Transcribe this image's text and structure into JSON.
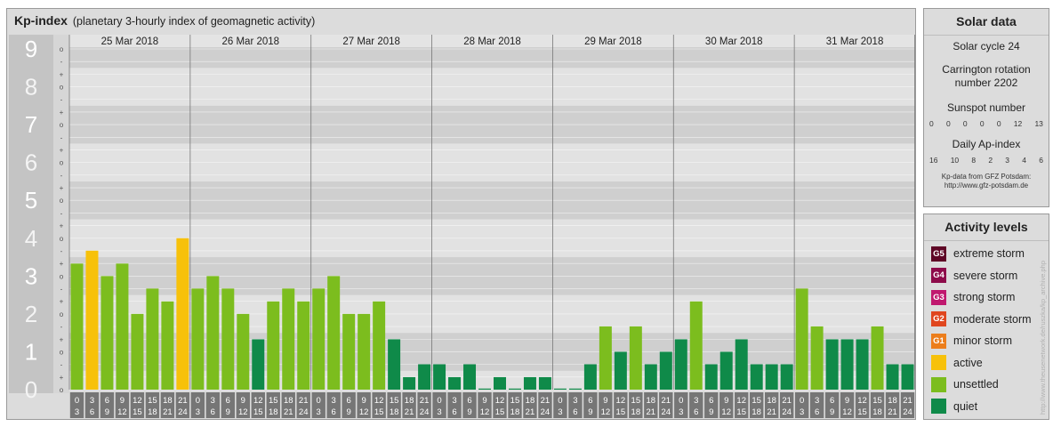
{
  "header": {
    "title": "Kp-index",
    "subtitle": "(planetary 3-hourly index of geomagnetic activity)"
  },
  "chart_data": {
    "type": "bar",
    "title": "Kp-index",
    "subtitle": "(planetary 3-hourly index of geomagnetic activity)",
    "ylim": [
      0,
      9.33
    ],
    "y_ticks": [
      "0",
      "1",
      "2",
      "3",
      "4",
      "5",
      "6",
      "7",
      "8",
      "9"
    ],
    "minor_ticks": [
      "o",
      "+",
      "-"
    ],
    "days": [
      "25 Mar 2018",
      "26 Mar 2018",
      "27 Mar 2018",
      "28 Mar 2018",
      "29 Mar 2018",
      "30 Mar 2018",
      "31 Mar 2018"
    ],
    "interval_labels": [
      [
        "0",
        "3"
      ],
      [
        "3",
        "6"
      ],
      [
        "6",
        "9"
      ],
      [
        "9",
        "12"
      ],
      [
        "12",
        "15"
      ],
      [
        "15",
        "18"
      ],
      [
        "18",
        "21"
      ],
      [
        "21",
        "24"
      ]
    ],
    "values": [
      3.33,
      3.67,
      3.0,
      3.33,
      2.0,
      2.67,
      2.33,
      4.0,
      2.67,
      3.0,
      2.67,
      2.0,
      1.33,
      2.33,
      2.67,
      2.33,
      2.67,
      3.0,
      2.0,
      2.0,
      2.33,
      1.33,
      0.33,
      0.67,
      0.67,
      0.33,
      0.67,
      0.0,
      0.33,
      0.0,
      0.33,
      0.33,
      0.0,
      0.0,
      0.67,
      1.67,
      1.0,
      1.67,
      0.67,
      1.0,
      1.33,
      2.33,
      0.67,
      1.0,
      1.33,
      0.67,
      0.67,
      0.67,
      2.67,
      1.67,
      1.33,
      1.33,
      1.33,
      1.67,
      0.67,
      0.67
    ],
    "activity_colors": {
      "quiet": "#0f8a49",
      "unsettled": "#7cbd1e",
      "active": "#f7c10a"
    }
  },
  "solar": {
    "title": "Solar data",
    "cycle": "Solar cycle 24",
    "carrington_line1": "Carrington rotation",
    "carrington_line2": "number 2202",
    "sunspot_title": "Sunspot number",
    "sunspot_values": [
      "0",
      "0",
      "0",
      "0",
      "0",
      "12",
      "13"
    ],
    "ap_title": "Daily Ap-index",
    "ap_values": [
      "16",
      "10",
      "8",
      "2",
      "3",
      "4",
      "6"
    ],
    "source_line1": "Kp-data from GFZ Potsdam:",
    "source_line2": "http://www.gfz-potsdam.de"
  },
  "activity": {
    "title": "Activity levels",
    "items": [
      {
        "code": "G5",
        "label": "extreme storm",
        "color": "#5e0525"
      },
      {
        "code": "G4",
        "label": "severe storm",
        "color": "#8d0b4a"
      },
      {
        "code": "G3",
        "label": "strong storm",
        "color": "#c0186f"
      },
      {
        "code": "G2",
        "label": "moderate storm",
        "color": "#e0461e"
      },
      {
        "code": "G1",
        "label": "minor storm",
        "color": "#ec7e1c"
      },
      {
        "code": "",
        "label": "active",
        "color": "#f7c10a"
      },
      {
        "code": "",
        "label": "unsettled",
        "color": "#7cbd1e"
      },
      {
        "code": "",
        "label": "quiet",
        "color": "#0f8a49"
      }
    ]
  },
  "credit": "http://www.theusenetwork.de/ruszka/kp_archive.php"
}
